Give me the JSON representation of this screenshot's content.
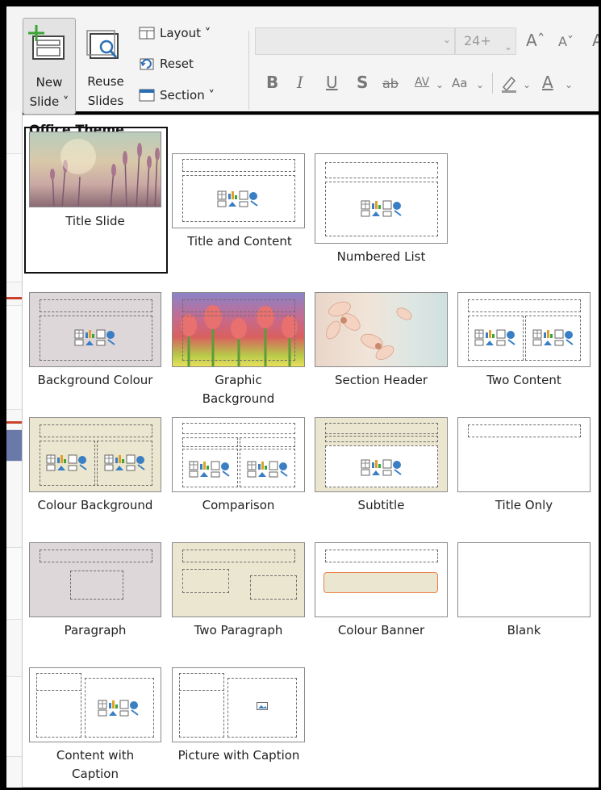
{
  "ribbon": {
    "new_slide": {
      "line1": "New",
      "line2": "Slide ˅"
    },
    "reuse_slides": {
      "line1": "Reuse",
      "line2": "Slides"
    },
    "layout": "Layout ˅",
    "reset": "Reset",
    "section": "Section ˅",
    "font_name": "",
    "font_size": "24+",
    "format": {
      "bold": "B",
      "italic": "I",
      "underline": "U",
      "shadow": "S",
      "strike": "ab",
      "spacing": "AV",
      "change_case": "Aa",
      "grow": "Aˆ",
      "shrink": "Aˇ"
    }
  },
  "gallery": {
    "title": "Office Theme",
    "layouts": [
      {
        "id": "title-slide",
        "caption": "Title Slide"
      },
      {
        "id": "title-and-content",
        "caption": "Title and Content"
      },
      {
        "id": "numbered-list",
        "caption": "Numbered List"
      },
      {
        "id": "background-colour",
        "caption": "Background Colour"
      },
      {
        "id": "graphic-background",
        "caption_line1": "Graphic",
        "caption_line2": "Background"
      },
      {
        "id": "section-header",
        "caption": "Section Header"
      },
      {
        "id": "two-content",
        "caption": "Two Content"
      },
      {
        "id": "colour-background",
        "caption": "Colour Background"
      },
      {
        "id": "comparison",
        "caption": "Comparison"
      },
      {
        "id": "subtitle",
        "caption": "Subtitle"
      },
      {
        "id": "title-only",
        "caption": "Title Only"
      },
      {
        "id": "paragraph",
        "caption": "Paragraph"
      },
      {
        "id": "two-paragraph",
        "caption": "Two Paragraph"
      },
      {
        "id": "colour-banner",
        "caption": "Colour Banner"
      },
      {
        "id": "blank",
        "caption": "Blank"
      },
      {
        "id": "content-with-caption",
        "caption_line1": "Content with",
        "caption_line2": "Caption"
      },
      {
        "id": "picture-with-caption",
        "caption": "Picture with Caption"
      }
    ]
  },
  "colors": {
    "beige": "#ebe6cf",
    "mauve": "#ddd7da",
    "banner": "#ebe6cf",
    "banner_border": "#e8824a"
  }
}
